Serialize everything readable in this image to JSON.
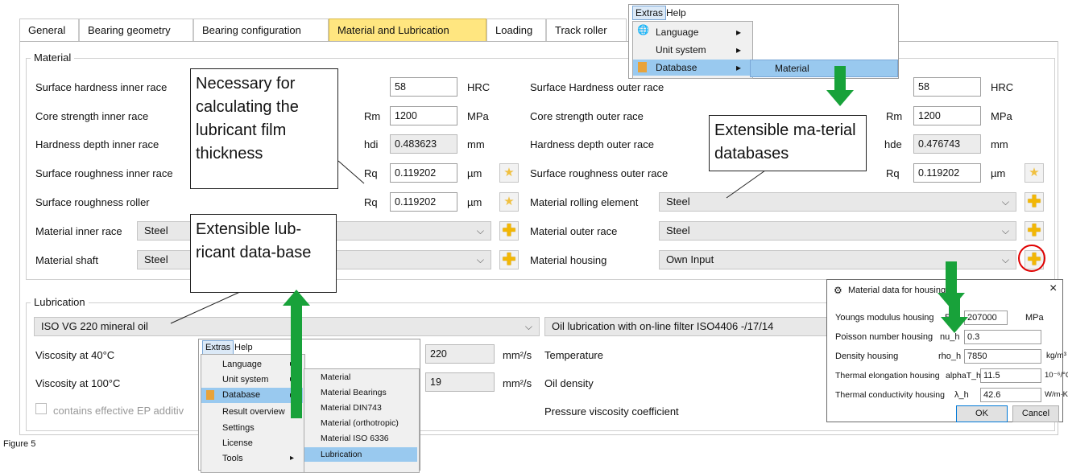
{
  "tabs": [
    "General",
    "Bearing geometry",
    "Bearing configuration",
    "Material and Lubrication",
    "Loading",
    "Track roller"
  ],
  "material": {
    "legend": "Material",
    "left_rows": [
      {
        "label": "Surface hardness inner race",
        "sym": "",
        "value": "58",
        "unit": "HRC"
      },
      {
        "label": "Core strength inner race",
        "sym": "Rm",
        "value": "1200",
        "unit": "MPa"
      },
      {
        "label": "Hardness depth inner race",
        "sym": "hdi",
        "value": "0.483623",
        "unit": "mm"
      },
      {
        "label": "Surface roughness inner race",
        "sym": "Rq",
        "value": "0.119202",
        "unit": "µm"
      },
      {
        "label": "Surface roughness roller",
        "sym": "Rq",
        "value": "0.119202",
        "unit": "µm"
      }
    ],
    "right_rows": [
      {
        "label": "Surface Hardness outer race",
        "sym": "",
        "value": "58",
        "unit": "HRC"
      },
      {
        "label": "Core strength outer race",
        "sym": "Rm",
        "value": "1200",
        "unit": "MPa"
      },
      {
        "label": "Hardness depth outer race",
        "sym": "hde",
        "value": "0.476743",
        "unit": "mm"
      },
      {
        "label": "Surface roughness outer race",
        "sym": "Rq",
        "value": "0.119202",
        "unit": "µm"
      }
    ],
    "material_inner_race_label": "Material inner race",
    "material_inner_race_value": "Steel",
    "material_shaft_label": "Material shaft",
    "material_shaft_value": "Steel",
    "material_rolling_label": "Material rolling element",
    "material_rolling_value": "Steel",
    "material_outer_label": "Material outer race",
    "material_outer_value": "Steel",
    "material_housing_label": "Material housing",
    "material_housing_value": "Own Input"
  },
  "lubrication": {
    "legend": "Lubrication",
    "oil": "ISO VG 220 mineral oil",
    "filter": "Oil lubrication with on-line filter ISO4406 -/17/14",
    "visc40_label": "Viscosity at 40°C",
    "visc40_value": "220",
    "visc100_label": "Viscosity at 100°C",
    "visc100_value": "19",
    "visc_unit": "mm²/s",
    "temperature_label": "Temperature",
    "oil_density_label": "Oil density",
    "pressure_visc_label": "Pressure viscosity coefficient",
    "ep_label": "contains effective EP additiv"
  },
  "callouts": {
    "film": "Necessary for calculating the lubricant film thickness",
    "mat_db": "Extensible ma-terial databases",
    "lub_db": "Extensible lub-ricant data-base"
  },
  "menu_top": {
    "bar": [
      "Extras",
      "Help"
    ],
    "items": [
      "Language",
      "Unit system",
      "Database"
    ],
    "sub": [
      "Material"
    ]
  },
  "menu_bottom": {
    "bar": [
      "Extras",
      "Help"
    ],
    "items": [
      "Language",
      "Unit system",
      "Database",
      "Result overview",
      "Settings",
      "License",
      "Tools"
    ],
    "sub": [
      "Material",
      "Material Bearings",
      "Material DIN743",
      "Material (orthotropic)",
      "Material ISO 6336",
      "Lubrication"
    ]
  },
  "dialog": {
    "title": "Material data for housing",
    "rows": [
      {
        "label": "Youngs modulus housing",
        "sym": "E_h",
        "value": "207000",
        "unit": "MPa"
      },
      {
        "label": "Poisson number housing",
        "sym": "nu_h",
        "value": "0.3",
        "unit": ""
      },
      {
        "label": "Density housing",
        "sym": "rho_h",
        "value": "7850",
        "unit": "kg/m³"
      },
      {
        "label": "Thermal elongation housing",
        "sym": "alphaT_h",
        "value": "11.5",
        "unit": "10⁻⁶/°C"
      },
      {
        "label": "Thermal conductivity housing",
        "sym": "λ_h",
        "value": "42.6",
        "unit": "W/m·K"
      }
    ],
    "ok": "OK",
    "cancel": "Cancel",
    "close": "×"
  },
  "figure_caption": "Figure 5",
  "colors": {
    "active_tab": "#ffe680",
    "arrow": "#18a23a",
    "highlight_circle": "#e00000",
    "menu_selected": "#99c9ef"
  }
}
